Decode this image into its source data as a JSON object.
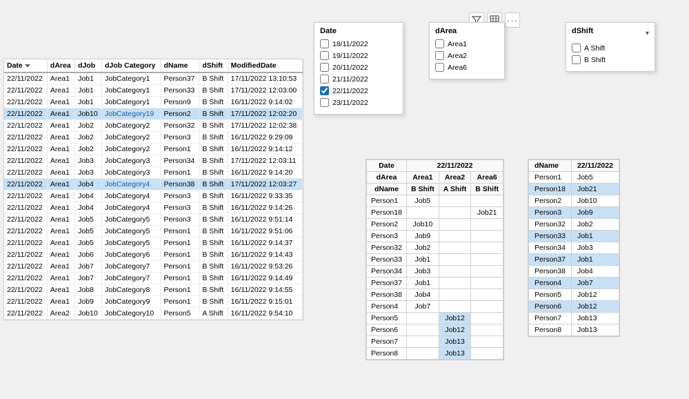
{
  "toolbar": {
    "filter_icon": "▼",
    "table_icon": "⊞",
    "more_icon": "···"
  },
  "date_filter": {
    "title": "Date",
    "options": [
      {
        "label": "18/11/2022",
        "checked": false
      },
      {
        "label": "19/11/2022",
        "checked": false
      },
      {
        "label": "20/11/2022",
        "checked": false
      },
      {
        "label": "21/11/2022",
        "checked": false
      },
      {
        "label": "22/11/2022",
        "checked": true
      },
      {
        "label": "23/11/2022",
        "checked": false
      }
    ]
  },
  "darea_filter": {
    "title": "dArea",
    "options": [
      {
        "label": "Area1",
        "checked": false
      },
      {
        "label": "Area2",
        "checked": false
      },
      {
        "label": "Area6",
        "checked": false
      }
    ]
  },
  "dshift_filter": {
    "title": "dShift",
    "options": [
      {
        "label": "A Shift",
        "checked": false
      },
      {
        "label": "B Shift",
        "checked": false
      }
    ]
  },
  "main_table": {
    "headers": [
      "Date",
      "dArea",
      "dJob",
      "dJob Category",
      "dName",
      "dShift",
      "ModifiedDate"
    ],
    "rows": [
      [
        "22/11/2022",
        "Area1",
        "Job1",
        "JobCategory1",
        "Person37",
        "B Shift",
        "17/11/2022 13:10:53"
      ],
      [
        "22/11/2022",
        "Area1",
        "Job1",
        "JobCategory1",
        "Person33",
        "B Shift",
        "17/11/2022 12:03:00"
      ],
      [
        "22/11/2022",
        "Area1",
        "Job1",
        "JobCategory1",
        "Person9",
        "B Shift",
        "16/11/2022 9:14:02"
      ],
      [
        "22/11/2022",
        "Area1",
        "Job10",
        "JobCategory19",
        "Person2",
        "B Shift",
        "17/11/2022 12:02:20"
      ],
      [
        "22/11/2022",
        "Area1",
        "Job2",
        "JobCategory2",
        "Person32",
        "B Shift",
        "17/11/2022 12:02:38"
      ],
      [
        "22/11/2022",
        "Area1",
        "Job2",
        "JobCategory2",
        "Person3",
        "B Shift",
        "16/11/2022 9:29:09"
      ],
      [
        "22/11/2022",
        "Area1",
        "Job2",
        "JobCategory2",
        "Person1",
        "B Shift",
        "16/11/2022 9:14:12"
      ],
      [
        "22/11/2022",
        "Area1",
        "Job3",
        "JobCategory3",
        "Person34",
        "B Shift",
        "17/11/2022 12:03:11"
      ],
      [
        "22/11/2022",
        "Area1",
        "Job3",
        "JobCategory3",
        "Person1",
        "B Shift",
        "16/11/2022 9:14:20"
      ],
      [
        "22/11/2022",
        "Area1",
        "Job4",
        "JobCategory4",
        "Person38",
        "B Shift",
        "17/11/2022 12:03:27"
      ],
      [
        "22/11/2022",
        "Area1",
        "Job4",
        "JobCategory4",
        "Person3",
        "B Shift",
        "16/11/2022 9:33:35"
      ],
      [
        "22/11/2022",
        "Area1",
        "Job4",
        "JobCategory4",
        "Person3",
        "B Shift",
        "16/11/2022 9:14:26"
      ],
      [
        "22/11/2022",
        "Area1",
        "Job5",
        "JobCategory5",
        "Person3",
        "B Shift",
        "16/11/2022 9:51:14"
      ],
      [
        "22/11/2022",
        "Area1",
        "Job5",
        "JobCategory5",
        "Person1",
        "B Shift",
        "16/11/2022 9:51:06"
      ],
      [
        "22/11/2022",
        "Area1",
        "Job5",
        "JobCategory5",
        "Person1",
        "B Shift",
        "16/11/2022 9:14:37"
      ],
      [
        "22/11/2022",
        "Area1",
        "Job6",
        "JobCategory6",
        "Person1",
        "B Shift",
        "16/11/2022 9:14:43"
      ],
      [
        "22/11/2022",
        "Area1",
        "Job7",
        "JobCategory7",
        "Person1",
        "B Shift",
        "16/11/2022 9:53:26"
      ],
      [
        "22/11/2022",
        "Area1",
        "Job7",
        "JobCategory7",
        "Person1",
        "B Shift",
        "16/11/2022 9:14:49"
      ],
      [
        "22/11/2022",
        "Area1",
        "Job8",
        "JobCategory8",
        "Person1",
        "B Shift",
        "16/11/2022 9:14:55"
      ],
      [
        "22/11/2022",
        "Area1",
        "Job9",
        "JobCategory9",
        "Person1",
        "B Shift",
        "16/11/2022 9:15:01"
      ],
      [
        "22/11/2022",
        "Area2",
        "Job10",
        "JobCategory10",
        "Person5",
        "A Shift",
        "16/11/2022 9:54:10"
      ]
    ]
  },
  "crossfilter": {
    "date_label": "Date",
    "date_value": "22/11/2022",
    "area_label": "dArea",
    "area_values": [
      "Area1",
      "Area2",
      "Area6"
    ],
    "dname_label": "dName",
    "shift_labels": [
      "B Shift",
      "A Shift",
      "B Shift"
    ],
    "rows": [
      {
        "name": "Person1",
        "values": [
          "Job5",
          "",
          ""
        ]
      },
      {
        "name": "Person18",
        "values": [
          "",
          "",
          "Job21"
        ]
      },
      {
        "name": "Person2",
        "values": [
          "Job10",
          "",
          ""
        ]
      },
      {
        "name": "Person3",
        "values": [
          "Job9",
          "",
          ""
        ]
      },
      {
        "name": "Person32",
        "values": [
          "Job2",
          "",
          ""
        ]
      },
      {
        "name": "Person33",
        "values": [
          "Job1",
          "",
          ""
        ]
      },
      {
        "name": "Person34",
        "values": [
          "Job3",
          "",
          ""
        ]
      },
      {
        "name": "Person37",
        "values": [
          "Job1",
          "",
          ""
        ]
      },
      {
        "name": "Person38",
        "values": [
          "Job4",
          "",
          ""
        ]
      },
      {
        "name": "Person4",
        "values": [
          "Job7",
          "",
          ""
        ]
      },
      {
        "name": "Person5",
        "values": [
          "",
          "Job12",
          ""
        ]
      },
      {
        "name": "Person6",
        "values": [
          "",
          "Job12",
          ""
        ]
      },
      {
        "name": "Person7",
        "values": [
          "",
          "Job13",
          ""
        ]
      },
      {
        "name": "Person8",
        "values": [
          "",
          "Job13",
          ""
        ]
      }
    ]
  },
  "dname_table": {
    "col1": "dName",
    "col2": "22/11/2022",
    "rows": [
      {
        "name": "Person1",
        "job": "Job5",
        "highlight": false
      },
      {
        "name": "Person18",
        "job": "Job21",
        "highlight": true
      },
      {
        "name": "Person2",
        "job": "Job10",
        "highlight": false
      },
      {
        "name": "Person3",
        "job": "Job9",
        "highlight": true
      },
      {
        "name": "Person32",
        "job": "Job2",
        "highlight": false
      },
      {
        "name": "Person33",
        "job": "Job1",
        "highlight": true
      },
      {
        "name": "Person34",
        "job": "Job3",
        "highlight": false
      },
      {
        "name": "Person37",
        "job": "Job1",
        "highlight": true
      },
      {
        "name": "Person38",
        "job": "Job4",
        "highlight": false
      },
      {
        "name": "Person4",
        "job": "Job7",
        "highlight": true
      },
      {
        "name": "Person5",
        "job": "Job12",
        "highlight": false
      },
      {
        "name": "Person6",
        "job": "Job12",
        "highlight": true
      },
      {
        "name": "Person7",
        "job": "Job13",
        "highlight": false
      },
      {
        "name": "Person8",
        "job": "Job13",
        "highlight": false
      }
    ]
  }
}
